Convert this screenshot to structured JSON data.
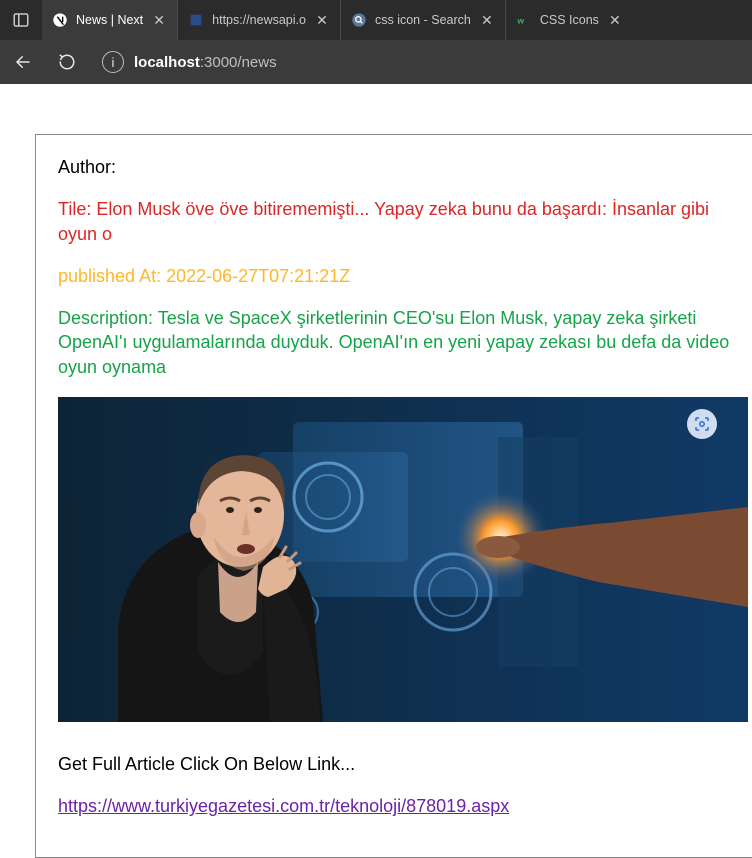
{
  "browser": {
    "tabs": [
      {
        "label": "News | Next",
        "active": true
      },
      {
        "label": "https://newsapi.o",
        "active": false
      },
      {
        "label": "css icon - Search",
        "active": false
      },
      {
        "label": "CSS Icons",
        "active": false
      }
    ],
    "url_host": "localhost",
    "url_rest": ":3000/news"
  },
  "article": {
    "author_label": "Author:",
    "title_line": "Tile: Elon Musk öve öve bitirememişti... Yapay zeka bunu da başardı: İnsanlar gibi oyun o",
    "published_line": "published At: 2022-06-27T07:21:21Z",
    "description_line": "Description: Tesla ve SpaceX şirketlerinin CEO'su Elon Musk, yapay zeka şirketi OpenAI'ı uygulamalarında duyduk. OpenAI'ın en yeni yapay zekası bu defa da video oyun oynama",
    "cta_text": "Get Full Article Click On Below Link...",
    "link_text": "https://www.turkiyegazetesi.com.tr/teknoloji/878019.aspx",
    "link_href": "https://www.turkiyegazetesi.com.tr/teknoloji/878019.aspx"
  }
}
